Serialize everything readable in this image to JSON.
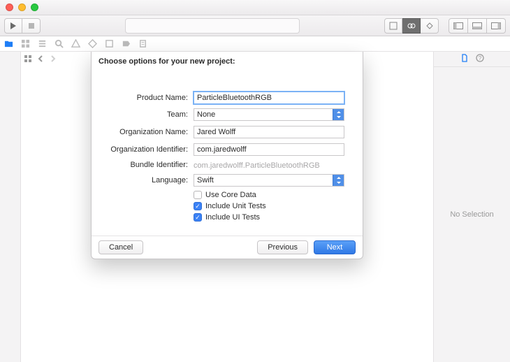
{
  "toolbar": {
    "run_icon": "play-icon",
    "stop_icon": "stop-icon"
  },
  "inspector": {
    "no_selection": "No Selection"
  },
  "sheet": {
    "title": "Choose options for your new project:",
    "labels": {
      "product_name": "Product Name:",
      "team": "Team:",
      "org_name": "Organization Name:",
      "org_id": "Organization Identifier:",
      "bundle_id": "Bundle Identifier:",
      "language": "Language:"
    },
    "values": {
      "product_name": "ParticleBluetoothRGB",
      "team": "None",
      "org_name": "Jared Wolff",
      "org_id": "com.jaredwolff",
      "bundle_id": "com.jaredwolff.ParticleBluetoothRGB",
      "language": "Swift"
    },
    "checks": {
      "core_data": "Use Core Data",
      "unit_tests": "Include Unit Tests",
      "ui_tests": "Include UI Tests"
    },
    "buttons": {
      "cancel": "Cancel",
      "previous": "Previous",
      "next": "Next"
    }
  }
}
